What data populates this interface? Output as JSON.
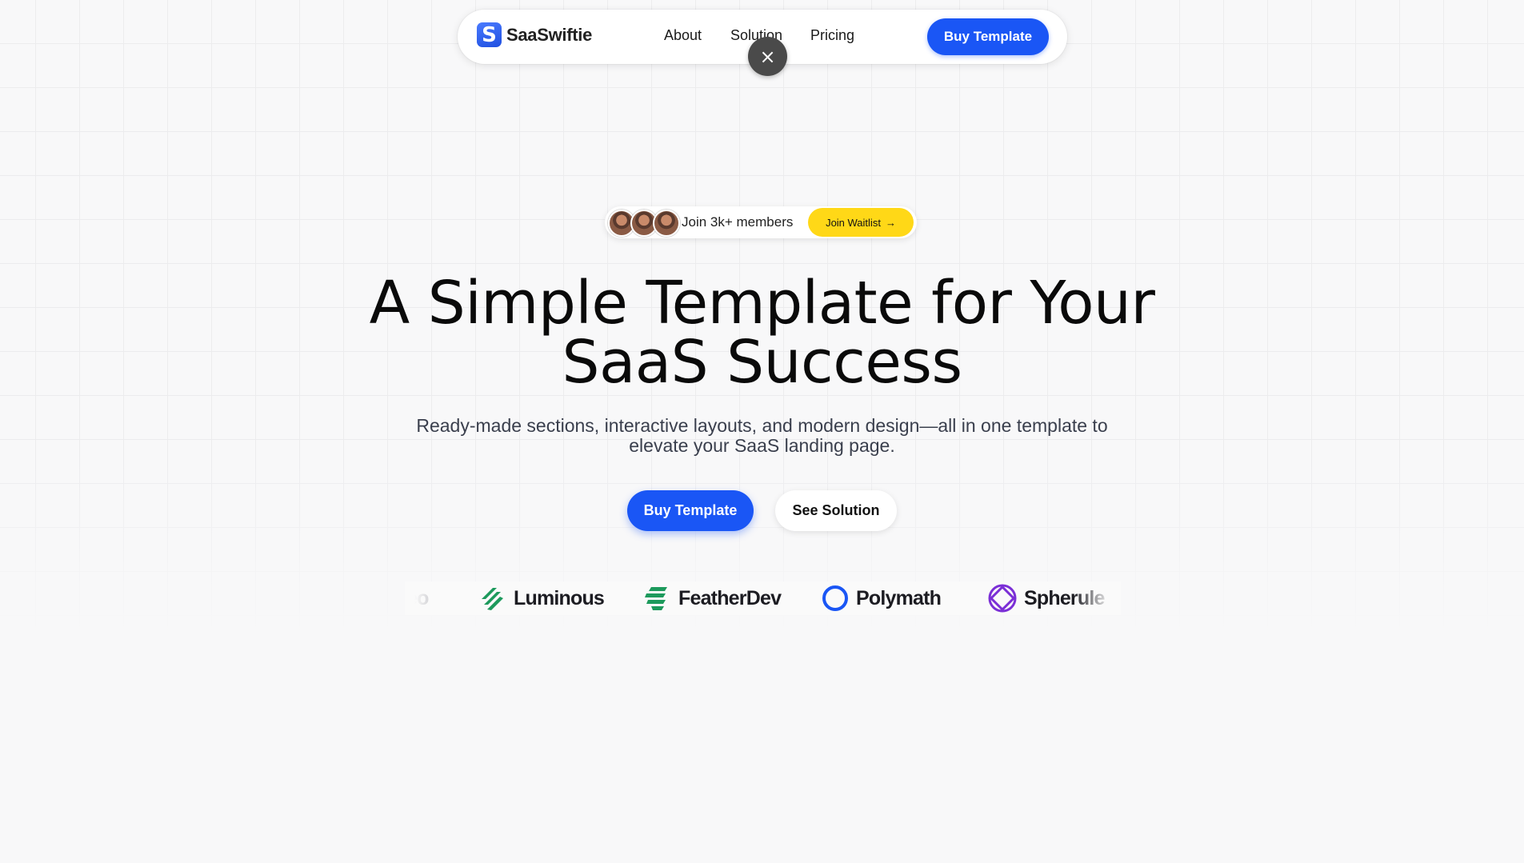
{
  "nav": {
    "brand": "SaaSwiftie",
    "logo_letter": "S",
    "links": [
      "About",
      "Solution",
      "Pricing"
    ],
    "cta": "Buy Template",
    "close_icon": "×"
  },
  "badge": {
    "text": "Join 3k+ members",
    "button": "Join Waitlist",
    "arrow": "→"
  },
  "hero": {
    "title_line1": "A Simple Template for Your",
    "title_line2": "SaaS Success",
    "subtitle": "Ready-made sections, interactive layouts, and modern design—all in one template to elevate your SaaS landing page.",
    "primary_cta": "Buy Template",
    "secondary_cta": "See Solution"
  },
  "logos": [
    "eo",
    "Luminous",
    "FeatherDev",
    "Polymath",
    "Spherule"
  ],
  "colors": {
    "accent": "#1a56f5",
    "waitlist": "#ffd817",
    "luminous": "#1d9a5c",
    "polymath": "#1a56f5",
    "spherule": "#7b2fd6"
  }
}
